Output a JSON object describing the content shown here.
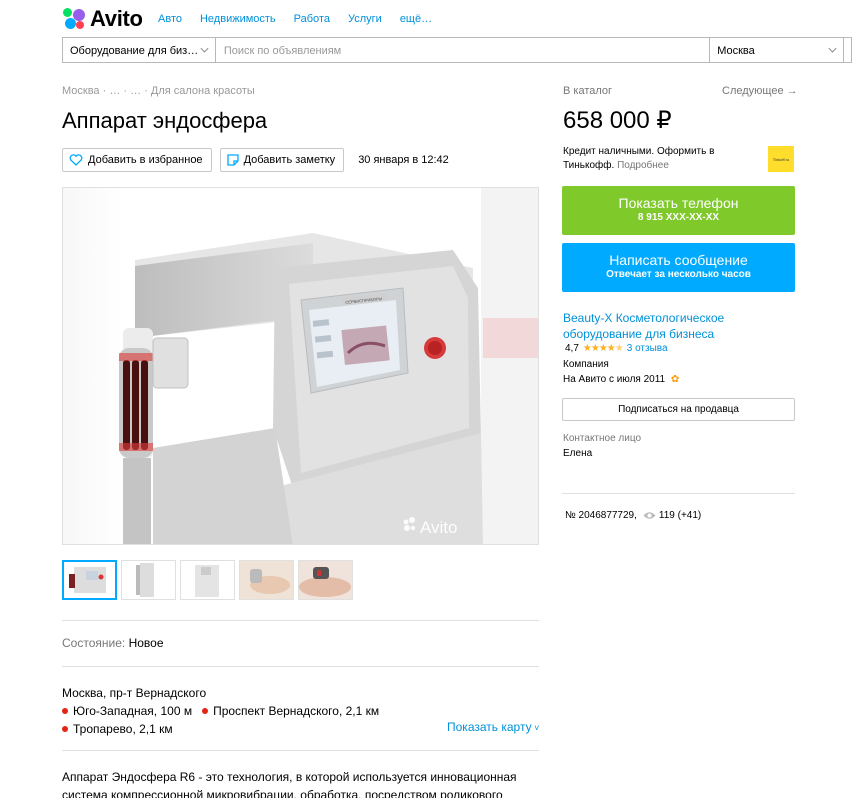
{
  "header": {
    "logo_text": "Avito",
    "nav": [
      "Авто",
      "Недвижимость",
      "Работа",
      "Услуги",
      "ещё…"
    ],
    "category_value": "Оборудование для биз…",
    "search_placeholder": "Поиск по объявлениям",
    "city_value": "Москва"
  },
  "breadcrumb": "Москва · … · … · Для салона красоты",
  "title": "Аппарат эндосфера",
  "actions": {
    "favorite_label": "Добавить в избранное",
    "note_label": "Добавить заметку",
    "date": "30 января в 12:42"
  },
  "gallery": {
    "watermark": "Avito",
    "screen_label": "СЕРВИСПРИБОРЫ"
  },
  "details": {
    "condition_label": "Состояние:",
    "condition_value": "Новое"
  },
  "address": {
    "line": "Москва, пр-т Вернадского",
    "metro": [
      {
        "name": "Юго-Западная, 100 м"
      },
      {
        "name": "Проспект Вернадского, 2,1 км"
      },
      {
        "name": "Тропарево, 2,1 км"
      }
    ],
    "show_map_label": "Показать карту"
  },
  "description": "Аппарат Эндосфера R6 - это технология, в которой используется инновационная система компрессионной микровибрации, обработка, посредством роликового",
  "sidebar": {
    "catalog_link": "В каталог",
    "next_link": "Следующее →",
    "price": "658 000 ₽",
    "credit_text": "Кредит наличными. Оформить в Тинькофф.",
    "credit_more": "Подробнее",
    "tinkoff_badge": "Tinkoff.ru",
    "phone_button": "Показать телефон",
    "phone_number": "8 915 XXX-XX-XX",
    "message_button": "Написать сообщение",
    "message_sub": "Отвечает за несколько часов",
    "seller_name": "Beauty-X Косметологическое оборудование для бизнеса",
    "rating_value": "4,7",
    "rating_stars": 4.7,
    "reviews": "3 отзыва",
    "seller_type": "Компания",
    "since": "На Авито с июля 2011",
    "subscribe_label": "Подписаться на продавца",
    "contact_label": "Контактное лицо",
    "contact_name": "Елена",
    "ad_number": "№ 2046877729,",
    "views": "119 (+41)"
  },
  "colors": {
    "link": "#0091d9",
    "phone_button": "#7fc92b",
    "message_button": "#00aaff",
    "metro_dot": "#e42313",
    "stars": "#ffb021"
  }
}
